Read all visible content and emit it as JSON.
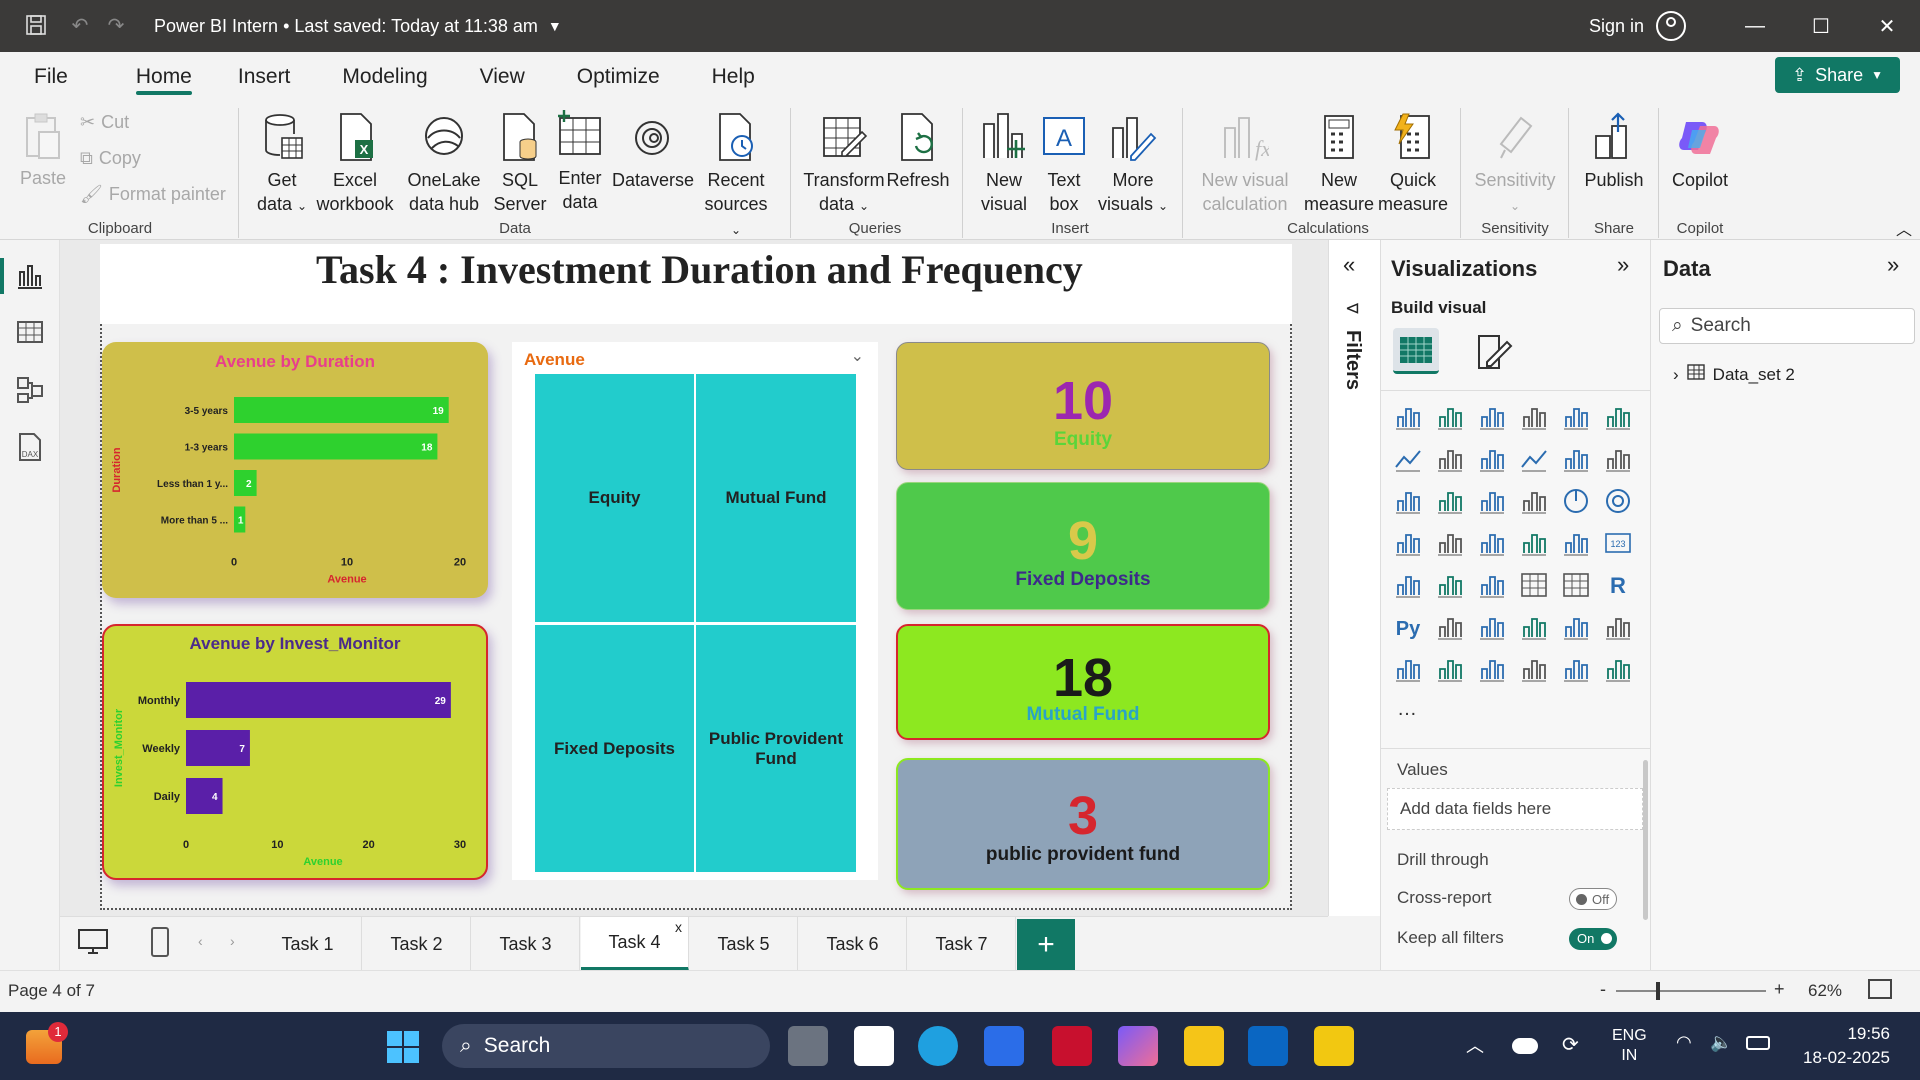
{
  "window": {
    "title": "Power BI Intern",
    "saved": "• Last saved: Today at 11:38 am",
    "sign_in": "Sign in"
  },
  "menu": [
    "File",
    "Home",
    "Insert",
    "Modeling",
    "View",
    "Optimize",
    "Help"
  ],
  "share_label": "Share",
  "ribbon": {
    "paste": "Paste",
    "cut": "Cut",
    "copy": "Copy",
    "format_painter": "Format painter",
    "get_data": "Get data",
    "excel": "Excel workbook",
    "onelake": "OneLake data hub",
    "sql": "SQL Server",
    "enter_data": "Enter data",
    "dataverse": "Dataverse",
    "recent": "Recent sources",
    "transform": "Transform data",
    "refresh": "Refresh",
    "new_visual": "New visual",
    "text_box": "Text box",
    "more_visuals": "More visuals",
    "new_visual_calc": "New visual calculation",
    "new_measure": "New measure",
    "quick_measure": "Quick measure",
    "sensitivity": "Sensitivity",
    "publish": "Publish",
    "copilot": "Copilot",
    "groups": {
      "clipboard": "Clipboard",
      "data": "Data",
      "queries": "Queries",
      "insert": "Insert",
      "calculations": "Calculations",
      "sensitivity": "Sensitivity",
      "share": "Share",
      "copilot": "Copilot"
    }
  },
  "report": {
    "title": "Task 4 : Investment Duration and Frequency",
    "chart1": {
      "title": "Avenue by Duration",
      "ylabel": "Duration",
      "xlabel": "Avenue"
    },
    "chart2": {
      "title": "Avenue by Invest_Monitor",
      "ylabel": "Invest_Monitor",
      "xlabel": "Avenue"
    },
    "treemap": {
      "title": "Avenue",
      "cells": [
        "Equity",
        "Mutual Fund",
        "Fixed Deposits",
        "Public Provident Fund"
      ]
    },
    "kpis": [
      {
        "value": "10",
        "label": "Equity"
      },
      {
        "value": "9",
        "label": "Fixed Deposits"
      },
      {
        "value": "18",
        "label": "Mutual Fund"
      },
      {
        "value": "3",
        "label": "public provident fund"
      }
    ]
  },
  "chart_data": [
    {
      "type": "bar",
      "orientation": "horizontal",
      "title": "Avenue by Duration",
      "xlabel": "Avenue",
      "ylabel": "Duration",
      "categories": [
        "3-5 years",
        "1-3 years",
        "Less than 1 y...",
        "More than 5 ..."
      ],
      "values": [
        19,
        18,
        2,
        1
      ],
      "xlim": [
        0,
        20
      ],
      "xticks": [
        0,
        10,
        20
      ],
      "bar_color": "#2ed12e"
    },
    {
      "type": "bar",
      "orientation": "horizontal",
      "title": "Avenue by Invest_Monitor",
      "xlabel": "Avenue",
      "ylabel": "Invest_Monitor",
      "categories": [
        "Monthly",
        "Weekly",
        "Daily"
      ],
      "values": [
        29,
        7,
        4
      ],
      "xlim": [
        0,
        30
      ],
      "xticks": [
        0,
        10,
        20,
        30
      ],
      "bar_color": "#5a1fa8"
    }
  ],
  "filters_label": "Filters",
  "viz": {
    "title": "Visualizations",
    "build": "Build visual",
    "values": "Values",
    "add_fields": "Add data fields here",
    "drill": "Drill through",
    "cross_report": "Cross-report",
    "cross_state": "Off",
    "keep_filters": "Keep all filters",
    "keep_state": "On"
  },
  "data_pane": {
    "title": "Data",
    "search": "Search",
    "table": "Data_set 2"
  },
  "pages": [
    "Task 1",
    "Task 2",
    "Task 3",
    "Task 4",
    "Task 5",
    "Task 6",
    "Task 7"
  ],
  "active_page": "Task 4",
  "status": {
    "page": "Page 4 of 7",
    "zoom": "62%"
  },
  "taskbar": {
    "search": "Search",
    "lang1": "ENG",
    "lang2": "IN",
    "time": "19:56",
    "date": "18-02-2025",
    "badge": "1"
  },
  "colors": {
    "accent": "#117865",
    "treemap": "#22cccc",
    "kpi1": "#cfbf4a",
    "kpi2": "#4fc94b",
    "kpi3": "#8de820",
    "kpi4": "#8ea3b8"
  }
}
